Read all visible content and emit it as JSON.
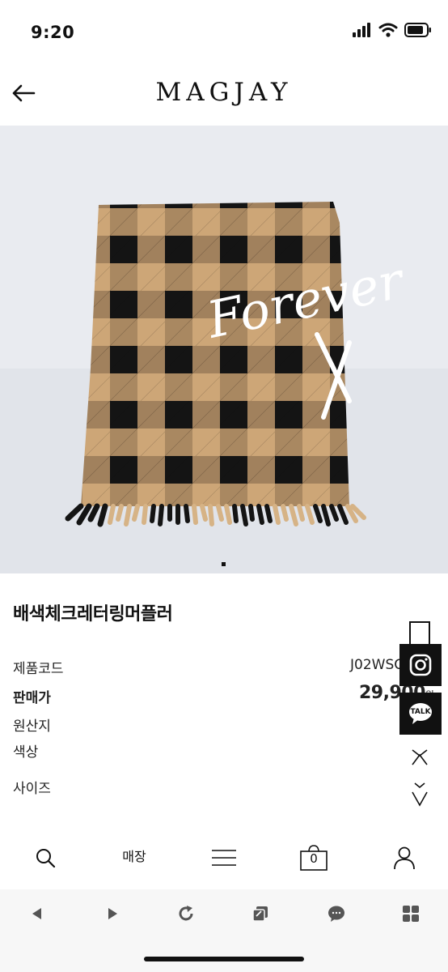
{
  "status_bar": {
    "time": "9:20"
  },
  "header": {
    "logo": "MAGJAY"
  },
  "product": {
    "image_text": "Forever",
    "title": "배색체크레터링머플러",
    "rows": [
      {
        "label": "제품코드",
        "value": "J02WSC"
      },
      {
        "label": "판매가",
        "value": "29,900",
        "unit": "원"
      },
      {
        "label": "원산지",
        "value": ""
      },
      {
        "label": "색상",
        "value": ""
      },
      {
        "label": "사이즈",
        "value": ""
      }
    ]
  },
  "float_buttons": {
    "kakao_label": "TALK"
  },
  "bottom_nav": {
    "store_label": "매장",
    "cart_count": "0"
  },
  "colors": {
    "check_tan": "#cda677",
    "check_black": "#141414",
    "brand": "#111111"
  },
  "icons": {
    "status": [
      "signal-icon",
      "wifi-icon",
      "battery-icon"
    ],
    "bottom_nav": [
      "search-icon",
      "menu-icon",
      "cart-icon",
      "user-icon"
    ],
    "browser": [
      "back-icon",
      "forward-icon",
      "refresh-icon",
      "tabs-icon",
      "chat-icon",
      "grid-icon"
    ]
  }
}
